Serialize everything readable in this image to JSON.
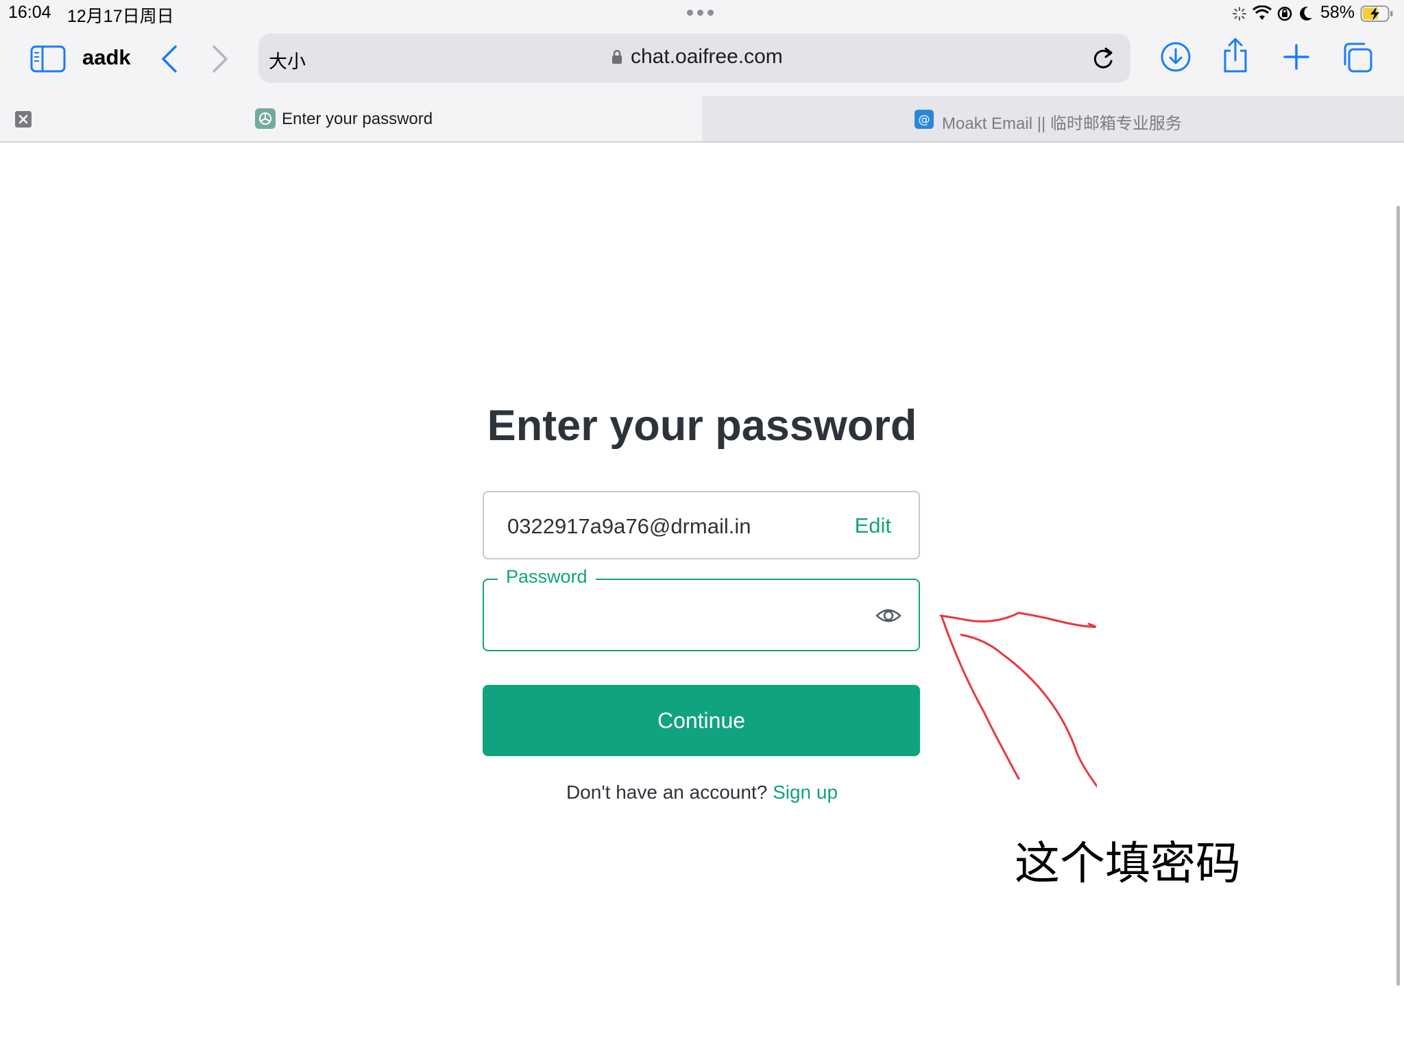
{
  "status_bar": {
    "time": "16:04",
    "date": "12月17日周日",
    "battery": "58%",
    "icons": [
      "activity-icon",
      "wifi-icon",
      "orientation-lock-icon",
      "moon-icon",
      "battery-charging-icon"
    ]
  },
  "toolbar": {
    "tab_group_title": "aadk",
    "reader_label": "大小",
    "url": "chat.oaifree.com",
    "icons": [
      "sidebar-icon",
      "back-icon",
      "forward-icon",
      "lock-icon",
      "reload-icon",
      "download-icon",
      "share-icon",
      "new-tab-icon",
      "tabs-overview-icon"
    ]
  },
  "tabs": [
    {
      "title": "Enter your password",
      "active": true,
      "icon": "chatgpt-logo-icon"
    },
    {
      "title": "Moakt Email || 临时邮箱专业服务",
      "active": false,
      "icon": "at-sign-icon"
    }
  ],
  "page": {
    "heading": "Enter your password",
    "email_value": "0322917a9a76@drmail.in",
    "edit_label": "Edit",
    "password_label": "Password",
    "password_value": "",
    "continue_label": "Continue",
    "no_account_text": "Don't have an account?",
    "signup_label": "Sign up"
  },
  "annotation": {
    "text": "这个填密码",
    "color": "#e8383d"
  },
  "colors": {
    "accent": "#10a37f",
    "browser_blue": "#1a7cf5",
    "heading": "#2d333a"
  }
}
